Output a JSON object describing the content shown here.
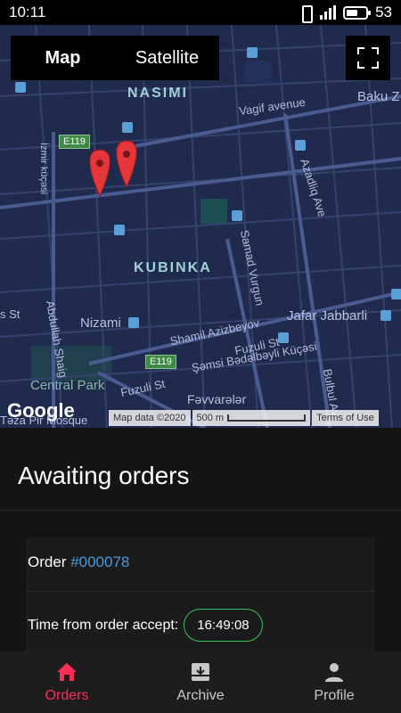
{
  "status_bar": {
    "time": "10:11",
    "battery": "53"
  },
  "map": {
    "toggle": {
      "map_label": "Map",
      "satellite_label": "Satellite",
      "selected": "Map"
    },
    "labels": {
      "nasimi": "NASIMI",
      "kubinka": "KUBINKA",
      "nizami": "Nizami",
      "jafar": "Jafar Jabbarli",
      "central_park": "Central Park",
      "baku": "Baku Z",
      "vagif": "Vagif avenue",
      "azadliq": "Azadliq Ave",
      "izmir": "İzmir küçəsi",
      "samad": "Samad Vurgun",
      "shamil": "Shamil Azizbeyov",
      "abdullah": "Abdullah Shaig",
      "fuzuli1": "Fuzuli St",
      "fuzuli2": "Fuzuli St",
      "semsi": "Şəmsi Bədəlbəyli Küçəsi",
      "bulbul": "Bulbul Av",
      "fevvareler": "Fəvvarələr",
      "mosque": "Təza Pir Mosque",
      "st_left": "s St",
      "road1": "E119",
      "road2": "E119"
    },
    "google": "Google",
    "attribution": {
      "map_data": "Map data ©2020",
      "scale": "500 m",
      "terms": "Terms of Use"
    },
    "colors": {
      "background": "#1f2a4d",
      "roads": "#3a4a7a",
      "marker": "#e5373b",
      "park": "#1d4f55"
    }
  },
  "content": {
    "title": "Awaiting orders",
    "order": {
      "label": "Order ",
      "number": "#000078"
    },
    "time_label": "Time from order accept:",
    "timer": "16:49:08"
  },
  "nav": {
    "items": [
      {
        "label": "Orders",
        "icon": "home-icon",
        "active": true
      },
      {
        "label": "Archive",
        "icon": "archive-icon",
        "active": false
      },
      {
        "label": "Profile",
        "icon": "person-icon",
        "active": false
      }
    ]
  }
}
